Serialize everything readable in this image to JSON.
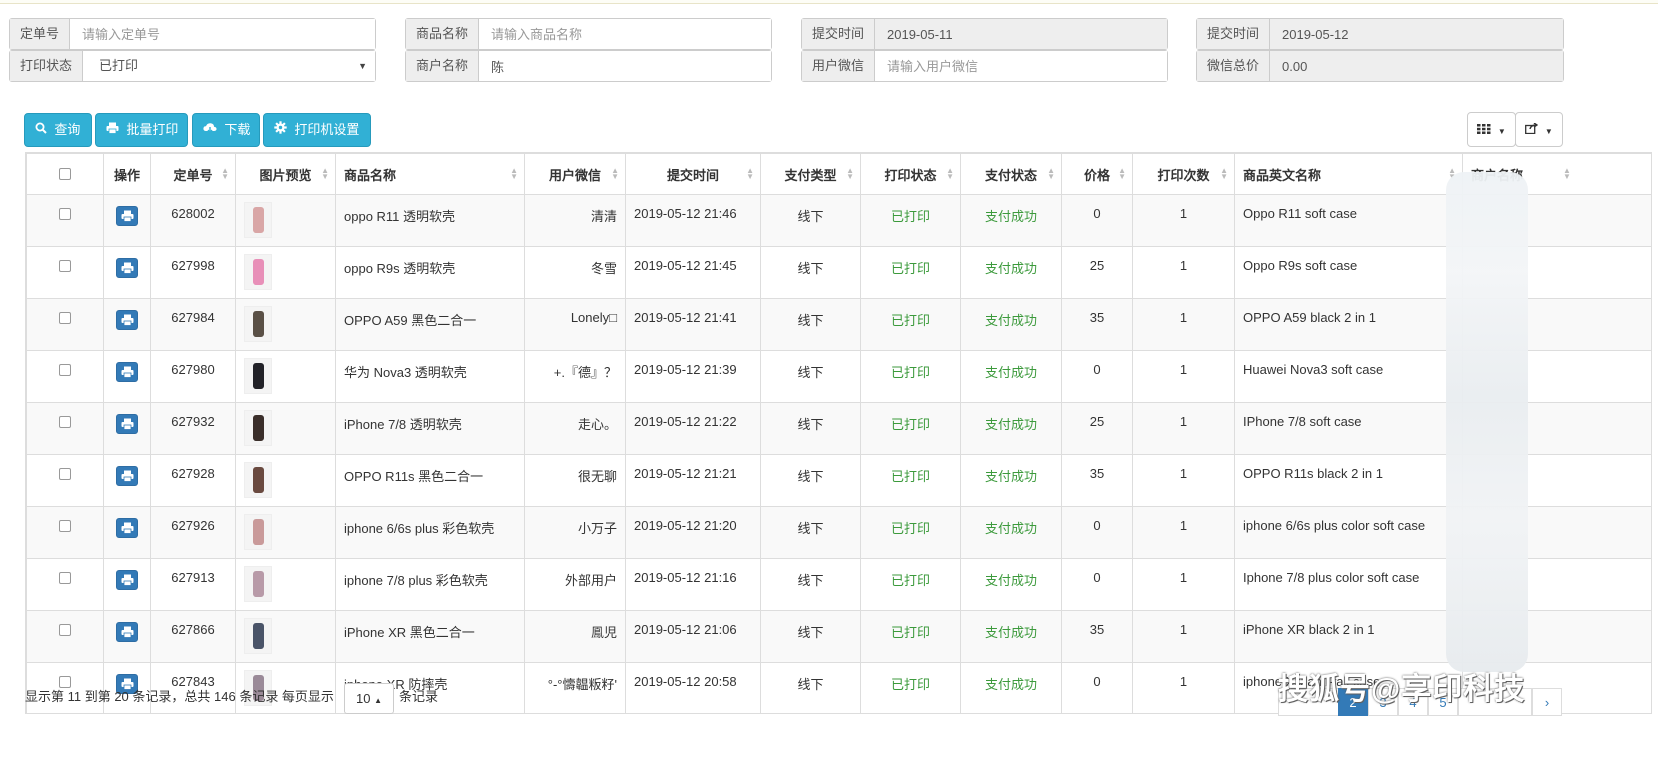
{
  "filters": {
    "order_no": {
      "label": "定单号",
      "placeholder": "请输入定单号",
      "value": ""
    },
    "print_status": {
      "label": "打印状态",
      "value": "已打印"
    },
    "product_name": {
      "label": "商品名称",
      "placeholder": "请输入商品名称",
      "value": ""
    },
    "merchant_name": {
      "label": "商户名称",
      "placeholder": "",
      "value": "陈"
    },
    "submit_from": {
      "label": "提交时间",
      "value": "2019-05-11"
    },
    "user_wechat": {
      "label": "用户微信",
      "placeholder": "请输入用户微信",
      "value": ""
    },
    "submit_to": {
      "label": "提交时间",
      "value": "2019-05-12"
    },
    "wechat_total": {
      "label": "微信总价",
      "value": "0.00"
    }
  },
  "toolbar": {
    "query": "查询",
    "batch_print": "批量打印",
    "download": "下载",
    "printer_settings": "打印机设置"
  },
  "table": {
    "headers": [
      "操作",
      "定单号",
      "图片预览",
      "商品名称",
      "用户微信",
      "提交时间",
      "支付类型",
      "打印状态",
      "支付状态",
      "价格",
      "打印次数",
      "商品英文名称",
      "商户名称"
    ],
    "rows": [
      {
        "order": "628002",
        "name": "oppo R11 透明软壳",
        "wechat": "清清",
        "time": "2019-05-12 21:46",
        "pay_type": "线下",
        "print_status": "已打印",
        "pay_status": "支付成功",
        "price": "0",
        "count": "1",
        "en_name": "Oppo R11 soft case",
        "thumb": "#d9a6a6"
      },
      {
        "order": "627998",
        "name": "oppo R9s 透明软壳",
        "wechat": "冬雪",
        "time": "2019-05-12 21:45",
        "pay_type": "线下",
        "print_status": "已打印",
        "pay_status": "支付成功",
        "price": "25",
        "count": "1",
        "en_name": "Oppo R9s soft case",
        "thumb": "#e88fb8"
      },
      {
        "order": "627984",
        "name": "OPPO A59 黑色二合一",
        "wechat": "Lonely□",
        "time": "2019-05-12 21:41",
        "pay_type": "线下",
        "print_status": "已打印",
        "pay_status": "支付成功",
        "price": "35",
        "count": "1",
        "en_name": "OPPO A59 black 2 in 1",
        "thumb": "#5a5046"
      },
      {
        "order": "627980",
        "name": "华为 Nova3 透明软壳",
        "wechat": "+.『德』？",
        "time": "2019-05-12 21:39",
        "pay_type": "线下",
        "print_status": "已打印",
        "pay_status": "支付成功",
        "price": "0",
        "count": "1",
        "en_name": "Huawei Nova3 soft case",
        "thumb": "#222228"
      },
      {
        "order": "627932",
        "name": "iPhone 7/8 透明软壳",
        "wechat": "走心。",
        "time": "2019-05-12 21:22",
        "pay_type": "线下",
        "print_status": "已打印",
        "pay_status": "支付成功",
        "price": "25",
        "count": "1",
        "en_name": "IPhone 7/8 soft case",
        "thumb": "#3a2e2a"
      },
      {
        "order": "627928",
        "name": "OPPO R11s 黑色二合一",
        "wechat": "很无聊",
        "time": "2019-05-12 21:21",
        "pay_type": "线下",
        "print_status": "已打印",
        "pay_status": "支付成功",
        "price": "35",
        "count": "1",
        "en_name": "OPPO R11s black 2 in 1",
        "thumb": "#6a4a40"
      },
      {
        "order": "627926",
        "name": "iphone 6/6s plus 彩色软壳",
        "wechat": "小万子",
        "time": "2019-05-12 21:20",
        "pay_type": "线下",
        "print_status": "已打印",
        "pay_status": "支付成功",
        "price": "0",
        "count": "1",
        "en_name": "iphone 6/6s plus color soft case",
        "thumb": "#c99a9a"
      },
      {
        "order": "627913",
        "name": "iphone 7/8 plus 彩色软壳",
        "wechat": "外部用户",
        "time": "2019-05-12 21:16",
        "pay_type": "线下",
        "print_status": "已打印",
        "pay_status": "支付成功",
        "price": "0",
        "count": "1",
        "en_name": "Iphone 7/8 plus color soft case",
        "thumb": "#b89aa8"
      },
      {
        "order": "627866",
        "name": "iPhone XR 黑色二合一",
        "wechat": "鳯児",
        "time": "2019-05-12 21:06",
        "pay_type": "线下",
        "print_status": "已打印",
        "pay_status": "支付成功",
        "price": "35",
        "count": "1",
        "en_name": "iPhone XR black 2 in 1",
        "thumb": "#4a5468"
      },
      {
        "order": "627843",
        "name": "iphone XR 防摔壳",
        "wechat": "°-°懤韞粄籽'",
        "time": "2019-05-12 20:58",
        "pay_type": "线下",
        "print_status": "已打印",
        "pay_status": "支付成功",
        "price": "0",
        "count": "1",
        "en_name": "iphone XR anti-fall case",
        "thumb": "#9a8a98"
      }
    ]
  },
  "footer": {
    "summary": "显示第 11 到第 20 条记录，总共 146 条记录 每页显示",
    "page_size": "10",
    "page_size_suffix": "条记录",
    "current_page": "2",
    "pages": [
      "2",
      "3",
      "4",
      "5",
      "›"
    ]
  },
  "watermark": "搜狐号@享印科技",
  "colors": {
    "primary": "#337ab7",
    "info": "#31b0d5",
    "success_text": "#3c9a3c"
  }
}
